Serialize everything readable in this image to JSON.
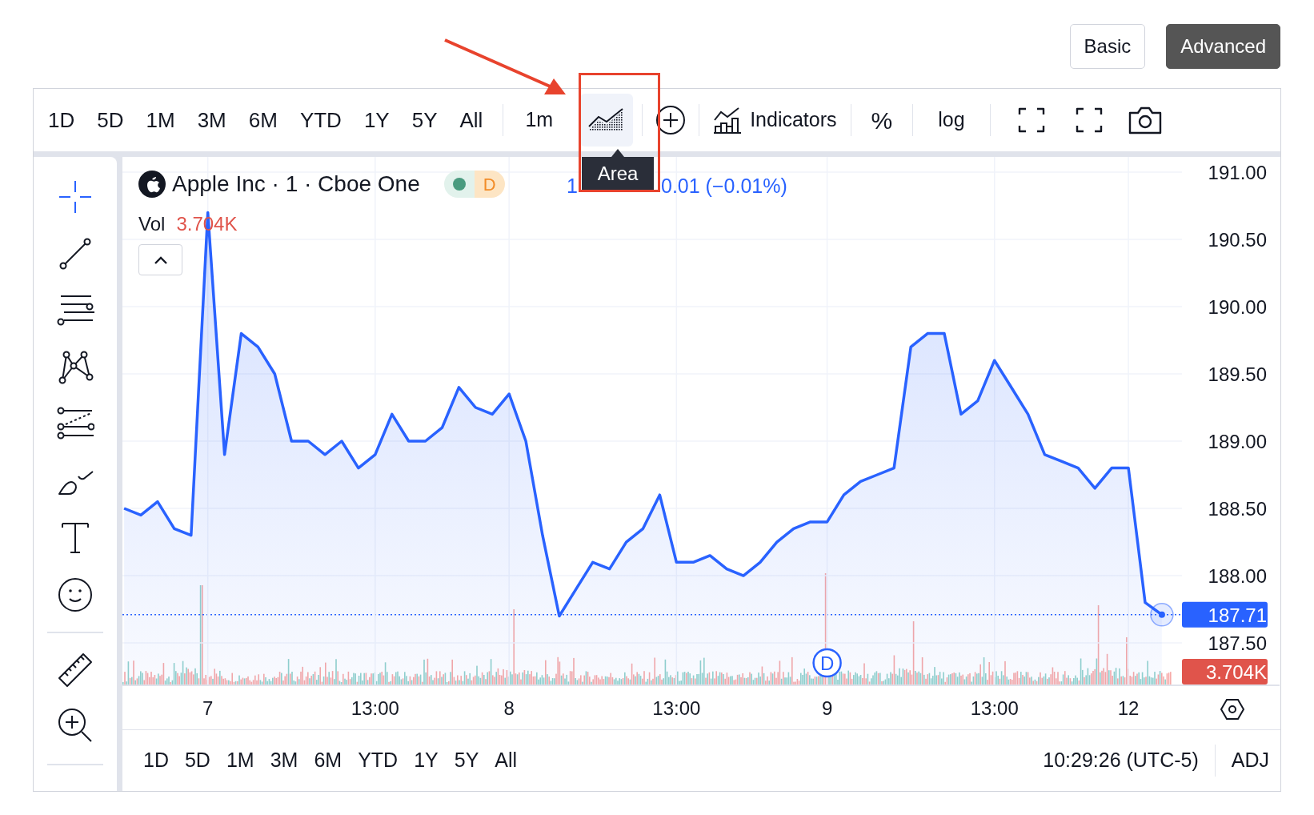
{
  "mode_switch": [
    {
      "label": "Basic",
      "selected": false
    },
    {
      "label": "Advanced",
      "selected": true
    }
  ],
  "toolbar": {
    "ranges": [
      {
        "label": "1D"
      },
      {
        "label": "5D"
      },
      {
        "label": "1M"
      },
      {
        "label": "3M"
      },
      {
        "label": "6M"
      },
      {
        "label": "YTD"
      },
      {
        "label": "1Y"
      },
      {
        "label": "5Y"
      },
      {
        "label": "All"
      }
    ],
    "interval": "1m",
    "chart_type": {
      "selected": true,
      "tooltip": "Area"
    },
    "indicators": "Indicators",
    "percent": "%",
    "log": "log"
  },
  "drawing_tools": [
    {
      "kind": "crosshair",
      "selected": true
    },
    {
      "kind": "trend-line",
      "selected": false
    },
    {
      "kind": "horizontal-lines",
      "selected": false
    },
    {
      "kind": "pattern",
      "selected": false
    },
    {
      "kind": "fibonacci",
      "selected": false
    },
    {
      "kind": "brush",
      "selected": false
    },
    {
      "kind": "text",
      "selected": false
    },
    {
      "kind": "emoji",
      "selected": false
    }
  ],
  "measure_tools": [
    {
      "kind": "ruler",
      "selected": false
    },
    {
      "kind": "zoom-in",
      "selected": false
    }
  ],
  "legend": {
    "title": "Apple Inc · 1 · Cboe One",
    "status_label": "D",
    "price_fragment": "1",
    "change_fragment": "0.01 (−0.01%)",
    "volume_label": "Vol",
    "volume_value": "3.704K"
  },
  "chart": {
    "last_price_tag": "187.71",
    "volume_tag": "3.704K",
    "chart_data": {
      "type": "area",
      "categories": [
        null,
        null,
        null,
        null,
        null,
        "7",
        null,
        null,
        null,
        null,
        null,
        null,
        null,
        null,
        null,
        "13:00",
        null,
        null,
        null,
        null,
        null,
        null,
        null,
        "8",
        null,
        null,
        null,
        null,
        null,
        null,
        null,
        null,
        null,
        "13:00",
        null,
        null,
        null,
        null,
        null,
        null,
        null,
        null,
        "9",
        null,
        null,
        null,
        null,
        null,
        null,
        null,
        null,
        null,
        "13:00",
        null,
        null,
        null,
        null,
        null,
        null,
        null,
        "12",
        null,
        null
      ],
      "series": [
        {
          "color": "#2962ff",
          "values": [
            188.5,
            188.45,
            188.55,
            188.35,
            188.3,
            190.7,
            188.9,
            189.8,
            189.7,
            189.5,
            189.0,
            189.0,
            188.9,
            189.0,
            188.8,
            188.9,
            189.2,
            189.0,
            189.0,
            189.1,
            189.4,
            189.25,
            189.2,
            189.35,
            189.0,
            188.3,
            187.7,
            187.9,
            188.1,
            188.05,
            188.25,
            188.35,
            188.6,
            188.1,
            188.1,
            188.15,
            188.05,
            188.0,
            188.1,
            188.25,
            188.35,
            188.4,
            188.4,
            188.6,
            188.7,
            188.75,
            188.8,
            189.7,
            189.8,
            189.8,
            189.2,
            189.3,
            189.6,
            189.4,
            189.2,
            188.9,
            188.85,
            188.8,
            188.65,
            188.8,
            188.8,
            187.8,
            187.71
          ]
        }
      ],
      "ylim": [
        187.185,
        191.113
      ],
      "yticks": [
        {
          "value": 187.5,
          "label": "187.50"
        },
        {
          "value": 188,
          "label": "188.00"
        },
        {
          "value": 188.5,
          "label": "188.50"
        },
        {
          "value": 189,
          "label": "189.00"
        },
        {
          "value": 189.5,
          "label": "189.50"
        },
        {
          "value": 190,
          "label": "190.00"
        },
        {
          "value": 190.5,
          "label": "190.50"
        },
        {
          "value": 191,
          "label": "191.00"
        }
      ],
      "grid": true,
      "annotations": [
        {
          "x": "9",
          "text": "D"
        }
      ]
    }
  },
  "bottom_bar": {
    "ranges": [
      {
        "label": "1D"
      },
      {
        "label": "5D"
      },
      {
        "label": "1M"
      },
      {
        "label": "3M"
      },
      {
        "label": "6M"
      },
      {
        "label": "YTD"
      },
      {
        "label": "1Y"
      },
      {
        "label": "5Y"
      },
      {
        "label": "All"
      }
    ],
    "clock": "10:29:26 (UTC-5)",
    "adjust": "ADJ"
  }
}
